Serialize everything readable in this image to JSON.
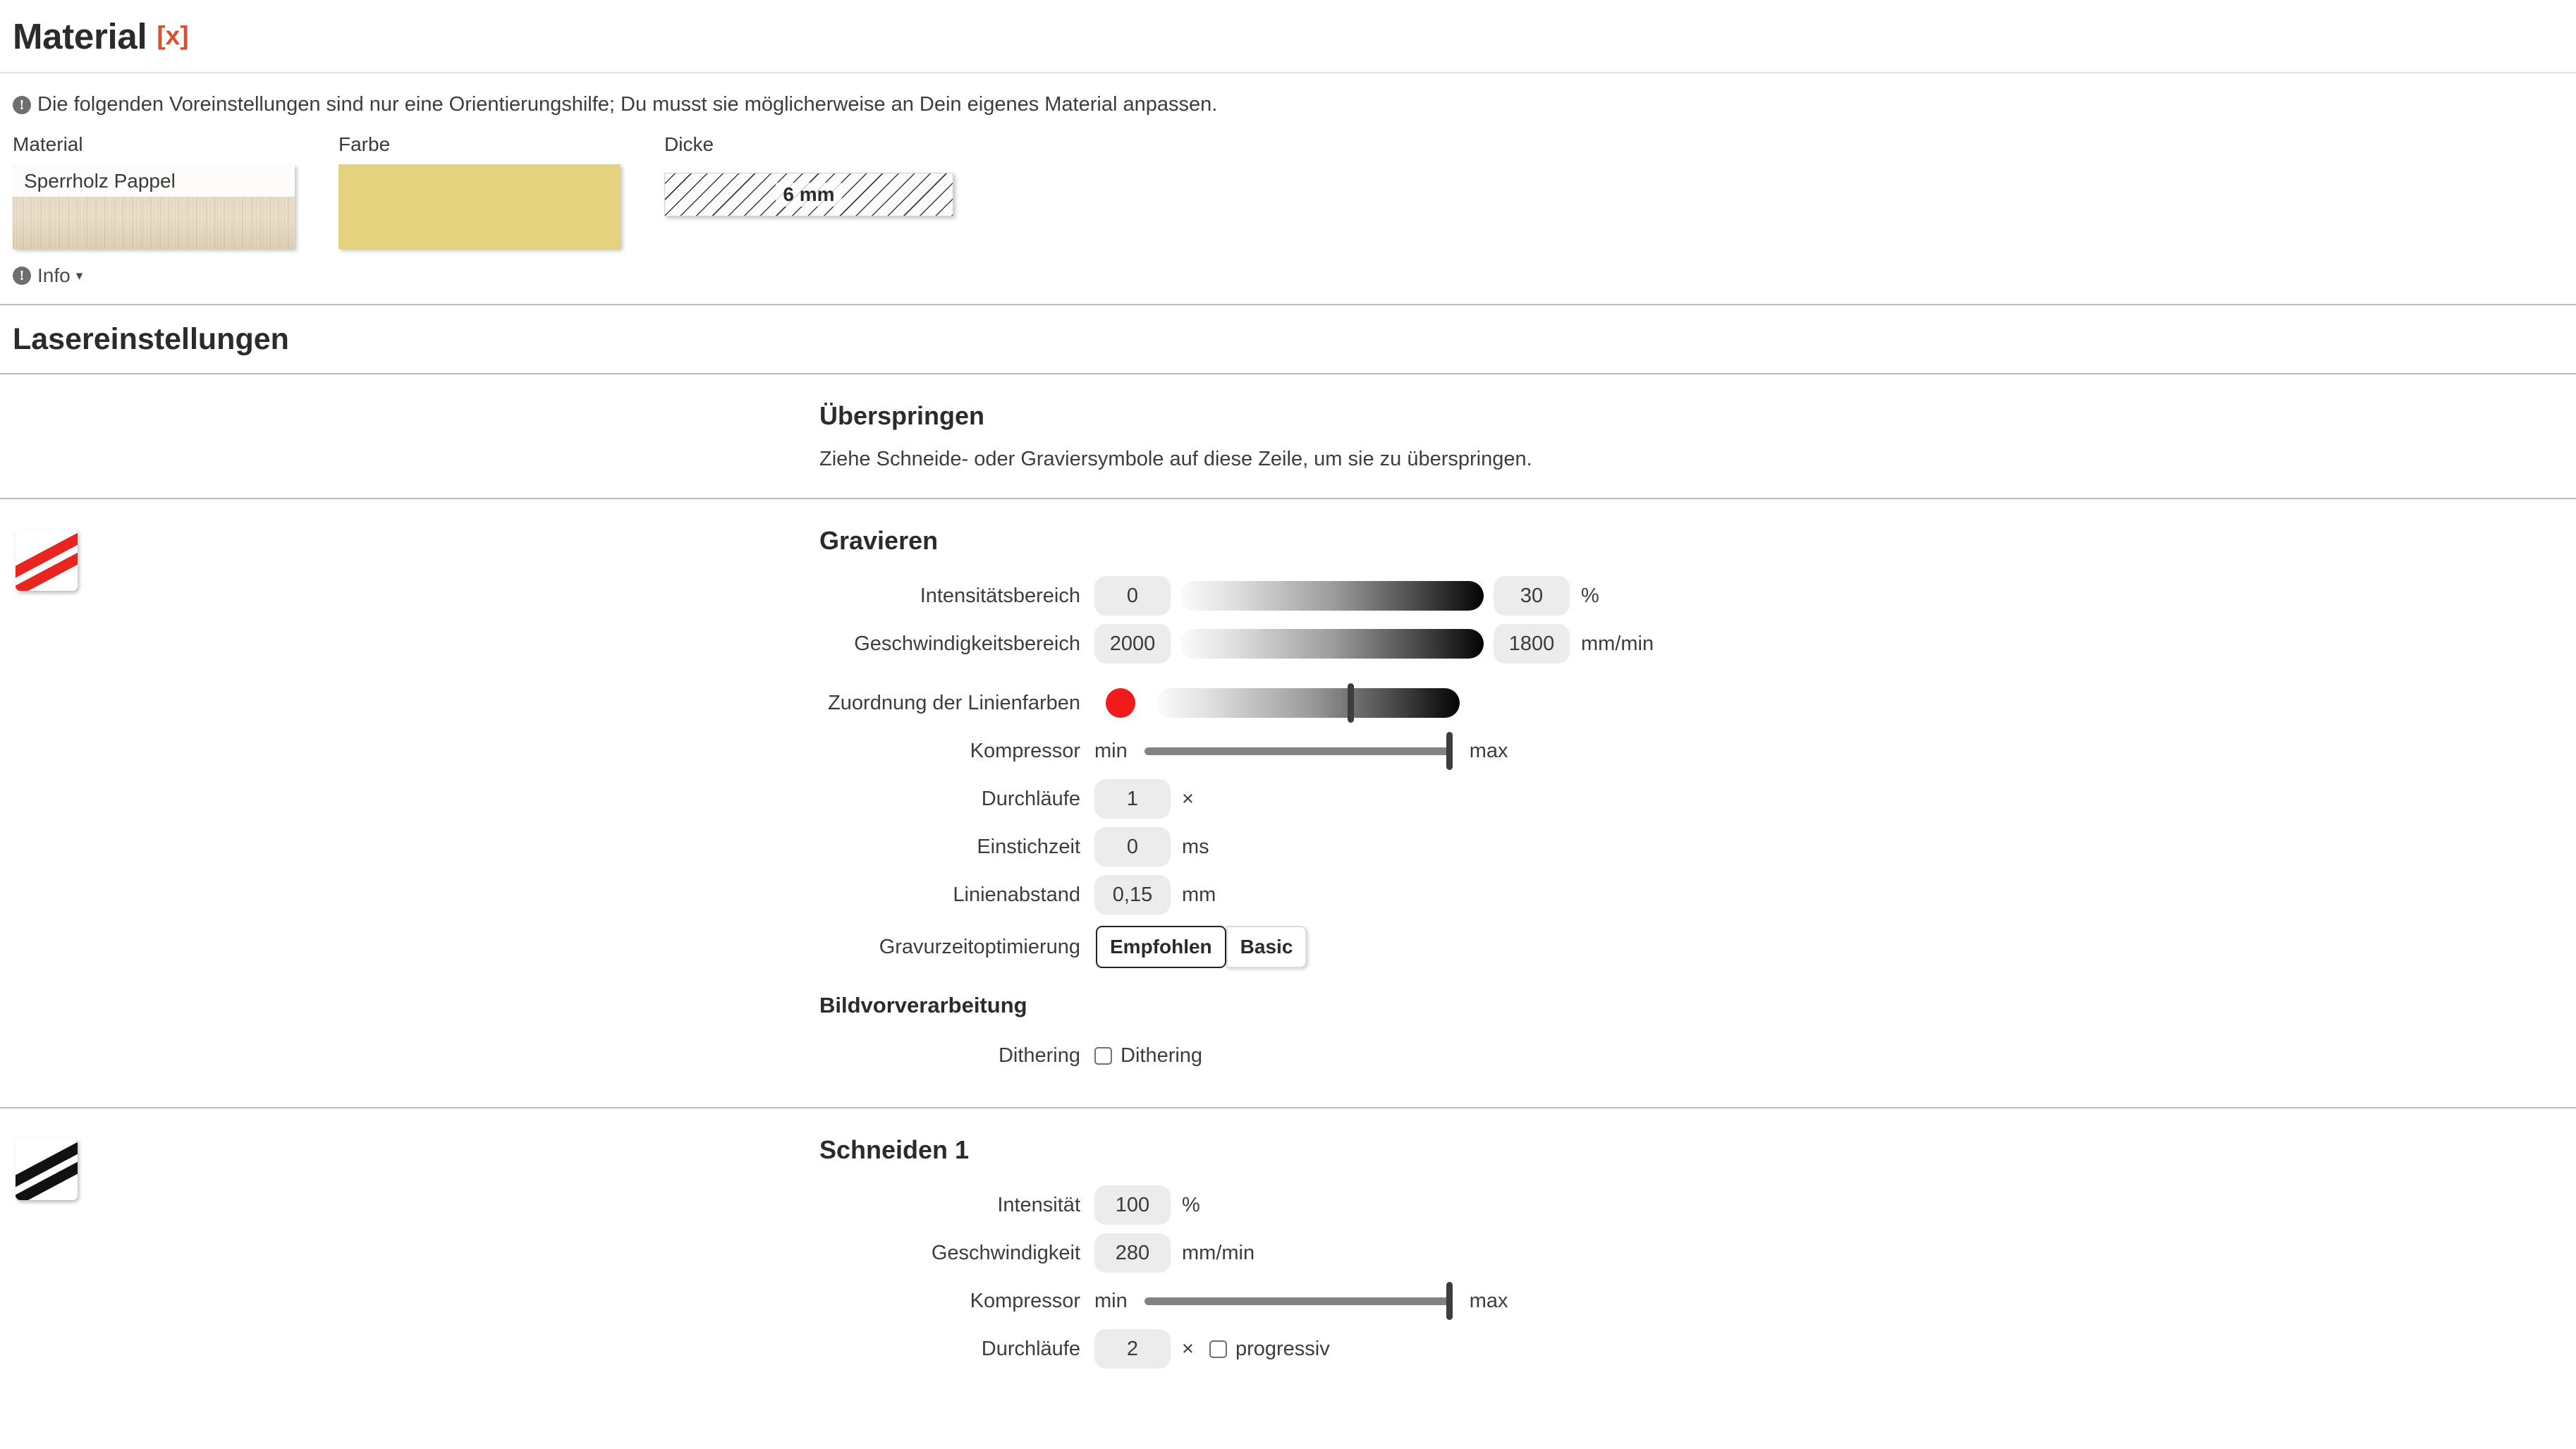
{
  "header": {
    "title": "Material",
    "close_label": "[x]",
    "close_color": "#d9502b"
  },
  "info_note": {
    "icon": "info-circle-icon",
    "text": "Die folgenden Voreinstellungen sind nur eine Orientierungshilfe; Du musst sie möglicherweise an Dein eigenes Material anpassen."
  },
  "swatches": {
    "material": {
      "label": "Material",
      "value": "Sperrholz Pappel"
    },
    "color": {
      "label": "Farbe",
      "value_hex": "#e5d27f"
    },
    "thickness": {
      "label": "Dicke",
      "value": "6 mm"
    }
  },
  "info_toggle": {
    "label": "Info",
    "caret": "▾"
  },
  "laser_settings": {
    "title": "Lasereinstellungen"
  },
  "skip_section": {
    "title": "Überspringen",
    "description": "Ziehe Schneide- oder Graviersymbole auf diese Zeile, um sie zu überspringen."
  },
  "engrave_section": {
    "title": "Gravieren",
    "icon": "engrave-stripes-icon",
    "rows": {
      "intensity": {
        "label": "Intensitätsbereich",
        "min_value": "0",
        "max_value": "30",
        "unit": "%"
      },
      "speed": {
        "label": "Geschwindigkeitsbereich",
        "min_value": "2000",
        "max_value": "1800",
        "unit": "mm/min"
      },
      "line_colors": {
        "label": "Zuordnung der Linienfarben",
        "color_hex": "#f01c1c",
        "thumb_percent": 63
      },
      "compressor": {
        "label": "Kompressor",
        "min_label": "min",
        "max_label": "max",
        "value_percent": 100
      },
      "passes": {
        "label": "Durchläufe",
        "value": "1",
        "unit": "×"
      },
      "pierce_time": {
        "label": "Einstichzeit",
        "value": "0",
        "unit": "ms"
      },
      "line_spacing": {
        "label": "Linienabstand",
        "value": "0,15",
        "unit": "mm"
      },
      "optimization": {
        "label": "Gravurzeitoptimierung",
        "options": [
          "Empfohlen",
          "Basic"
        ],
        "selected": "Empfohlen"
      }
    },
    "preprocessing": {
      "title": "Bildvorverarbeitung",
      "dithering": {
        "label": "Dithering",
        "checkbox_label": "Dithering",
        "checked": false
      }
    }
  },
  "cut_section": {
    "title": "Schneiden 1",
    "icon": "cut-stripes-icon",
    "rows": {
      "intensity": {
        "label": "Intensität",
        "value": "100",
        "unit": "%"
      },
      "speed": {
        "label": "Geschwindigkeit",
        "value": "280",
        "unit": "mm/min"
      },
      "compressor": {
        "label": "Kompressor",
        "min_label": "min",
        "max_label": "max",
        "value_percent": 100
      },
      "passes": {
        "label": "Durchläufe",
        "value": "2",
        "unit": "×",
        "progressive_label": "progressiv",
        "progressive_checked": false
      }
    }
  }
}
